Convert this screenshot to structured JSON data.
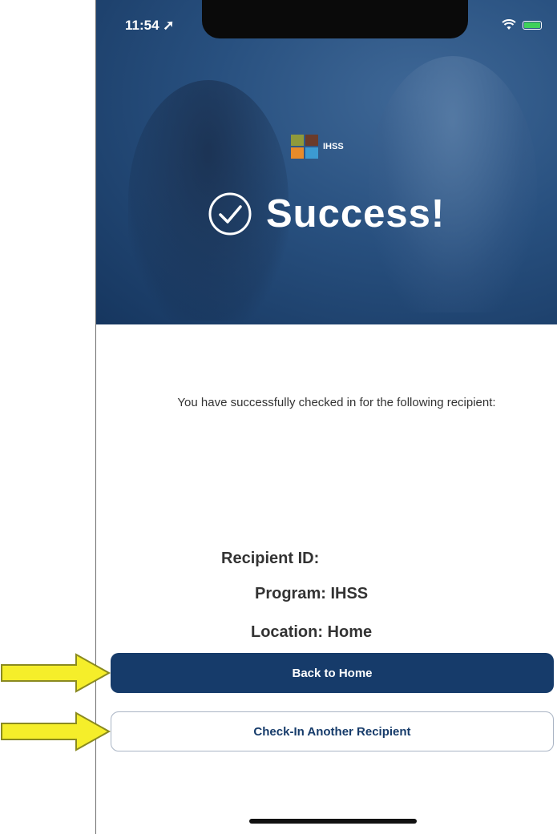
{
  "status_bar": {
    "time": "11:54 ➚"
  },
  "header": {
    "logo_text": "IHSS",
    "logo_colors": [
      "#8f9a3b",
      "#6b3b2a",
      "#e88b2a",
      "#3c9ad1"
    ],
    "success_title": "Success!"
  },
  "main": {
    "message": "You have successfully checked in for the following recipient:",
    "recipient_id_label": "Recipient ID:",
    "program_label": "Program: IHSS",
    "location_label": "Location: Home"
  },
  "actions": {
    "back_home_label": "Back to Home",
    "check_in_another_label": "Check-In Another Recipient"
  },
  "annotations": {
    "arrow_color": "#f5ee2a",
    "arrow_outline": "#8a8a20"
  }
}
